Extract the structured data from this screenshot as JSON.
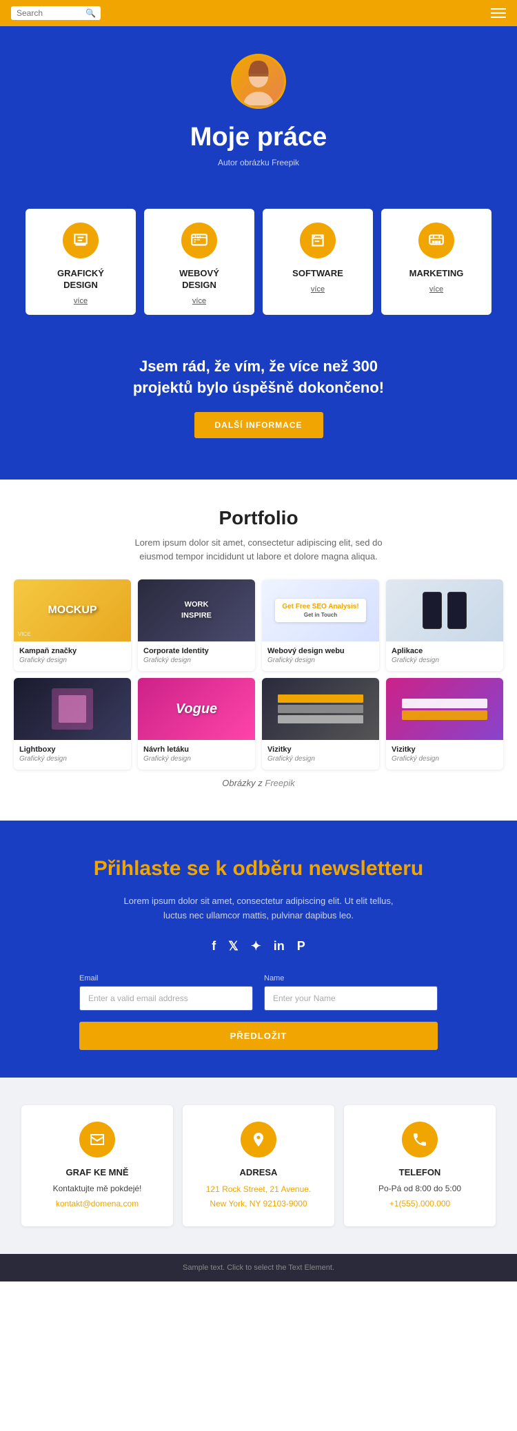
{
  "header": {
    "search_placeholder": "Search",
    "menu_label": "Menu"
  },
  "hero": {
    "title": "Moje práce",
    "subtitle": "Autor obrázku",
    "subtitle_link": "Freepik"
  },
  "services": [
    {
      "id": "graficky-design",
      "title": "GRAFICKÝ\nDESIGN",
      "link_label": "více",
      "icon": "graphic-design"
    },
    {
      "id": "webovy-design",
      "title": "WEBOVÝ\nDESIGN",
      "link_label": "více",
      "icon": "web-design"
    },
    {
      "id": "software",
      "title": "SOFTWARE",
      "link_label": "více",
      "icon": "software"
    },
    {
      "id": "marketing",
      "title": "MARKETING",
      "link_label": "více",
      "icon": "marketing"
    }
  ],
  "stats": {
    "text": "Jsem rád, že vím, že více než 300\nprojektů bylo úspěšně dokončeno!",
    "button_label": "DALŠÍ INFORMACE"
  },
  "portfolio": {
    "title": "Portfolio",
    "description": "Lorem ipsum dolor sit amet, consectetur adipiscing elit, sed do eiusmod tempor incididunt ut labore et dolore magna aliqua.",
    "items": [
      {
        "name": "Kampaň značky",
        "category": "Grafický design",
        "thumb_class": "thumb-1",
        "label": "MOCKUP"
      },
      {
        "name": "Corporate Identity",
        "category": "Grafický design",
        "thumb_class": "thumb-2",
        "label": "WORK\nINSPIRE"
      },
      {
        "name": "Webový design webu",
        "category": "Grafický design",
        "thumb_class": "thumb-3",
        "label": "SEO"
      },
      {
        "name": "Aplikace",
        "category": "Grafický design",
        "thumb_class": "thumb-4",
        "label": ""
      },
      {
        "name": "Lightboxy",
        "category": "Grafický design",
        "thumb_class": "thumb-5",
        "label": ""
      },
      {
        "name": "Návrh letáku",
        "category": "Grafický design",
        "thumb_class": "thumb-6",
        "label": "Vogue"
      },
      {
        "name": "Vizitky",
        "category": "Grafický design",
        "thumb_class": "thumb-7",
        "label": ""
      },
      {
        "name": "Vizitky",
        "category": "Grafický design",
        "thumb_class": "thumb-8",
        "label": ""
      }
    ],
    "credit": "Obrázky z",
    "credit_link": "Freepik"
  },
  "newsletter": {
    "title": "Přihlaste se k odběru newsletteru",
    "description": "Lorem ipsum dolor sit amet, consectetur adipiscing elit. Ut elit tellus, luctus nec ullamcor mattis, pulvinar dapibus leo.",
    "social": [
      "f",
      "t",
      "in",
      "in",
      "P"
    ],
    "email_label": "Email",
    "email_placeholder": "Enter a valid email address",
    "name_label": "Name",
    "name_placeholder": "Enter your Name",
    "submit_label": "PŘEDLOŽIT"
  },
  "contact": {
    "items": [
      {
        "id": "email",
        "title": "GRAF KE MNĚ",
        "line1": "Kontaktujte mě pokdejé!",
        "link_text": "kontakt@domena.com",
        "icon": "email"
      },
      {
        "id": "address",
        "title": "ADRESA",
        "line1": "121 Rock Street, 21 Avenue.",
        "line2": "New York, NY 92103-9000",
        "icon": "location"
      },
      {
        "id": "phone",
        "title": "TELEFON",
        "line1": "Po-Pá od 8:00 do 5:00",
        "link_text": "+1(555).000.000",
        "icon": "phone"
      }
    ]
  },
  "footer": {
    "text": "Sample text. Click to select the Text Element."
  }
}
